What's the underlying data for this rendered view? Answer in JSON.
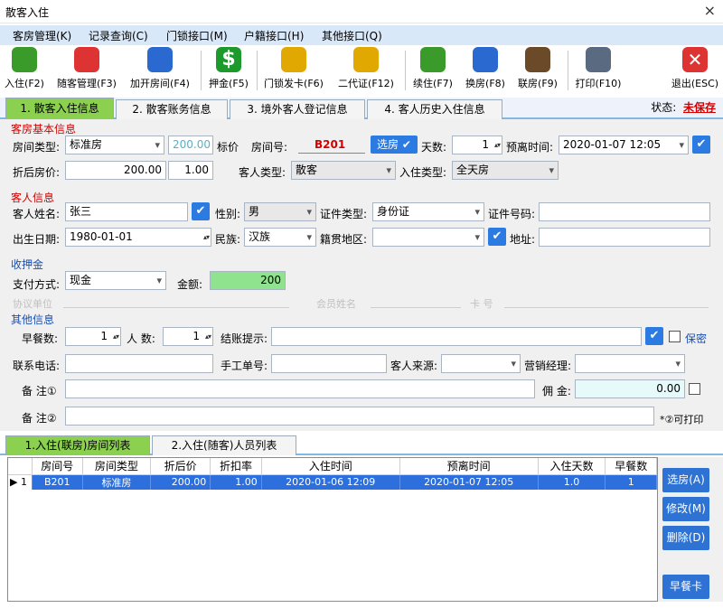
{
  "window": {
    "title": "散客入住",
    "close": "×"
  },
  "menu": [
    "客房管理(K)",
    "记录查询(C)",
    "门锁接口(M)",
    "户籍接口(H)",
    "其他接口(Q)"
  ],
  "toolbar": [
    {
      "label": "入住(F2)",
      "icon": "checkin-person-icon",
      "color": "#3a9a2a"
    },
    {
      "label": "随客管理(F3)",
      "icon": "guest-card-add-icon",
      "color": "#d33"
    },
    {
      "label": "加开房间(F4)",
      "icon": "cubes-icon",
      "color": "#2a6ad0"
    },
    {
      "label": "押金(F5)",
      "icon": "dollar-icon",
      "color": "#1c9a2c"
    },
    {
      "label": "门锁发卡(F6)",
      "icon": "key-card-icon",
      "color": "#e0a800"
    },
    {
      "label": "二代证(F12)",
      "icon": "id-keys-icon",
      "color": "#e0a800"
    },
    {
      "label": "续住(F7)",
      "icon": "add-person-icon",
      "color": "#3a9a2a"
    },
    {
      "label": "换房(F8)",
      "icon": "swap-person-icon",
      "color": "#2a6ad0"
    },
    {
      "label": "联房(F9)",
      "icon": "tools-icon",
      "color": "#6b4a2a"
    },
    {
      "label": "打印(F10)",
      "icon": "printer-icon",
      "color": "#5a6a80"
    },
    {
      "label": "退出(ESC)",
      "icon": "exit-x-icon",
      "color": "#d33"
    }
  ],
  "tabs": [
    "1. 散客入住信息",
    "2. 散客账务信息",
    "3. 境外客人登记信息",
    "4. 客人历史入住信息"
  ],
  "status": {
    "label": "状态:",
    "value": "未保存"
  },
  "room": {
    "section": "客房基本信息",
    "room_type_label": "房间类型:",
    "room_type": "标准房",
    "std_price": "200.00",
    "std_price_label": "标价",
    "room_no_label": "房间号:",
    "room_no": "B201",
    "select_room": "选房",
    "days_label": "天数:",
    "days": "1",
    "depart_label": "预离时间:",
    "depart": "2020-01-07 12:05",
    "discount_price_label": "折后房价:",
    "discount_price": "200.00",
    "discount_rate": "1.00",
    "guest_type_label": "客人类型:",
    "guest_type": "散客",
    "checkin_type_label": "入住类型:",
    "checkin_type": "全天房"
  },
  "guest": {
    "section": "客人信息",
    "name_label": "客人姓名:",
    "name": "张三",
    "gender_label": "性别:",
    "gender": "男",
    "id_type_label": "证件类型:",
    "id_type": "身份证",
    "id_no_label": "证件号码:",
    "id_no": "",
    "birth_label": "出生日期:",
    "birth": "1980-01-01",
    "nation_label": "民族:",
    "nation": "汉族",
    "origin_label": "籍贯地区:",
    "origin": "",
    "address_label": "地址:",
    "address": ""
  },
  "deposit": {
    "section": "收押金",
    "pay_label": "支付方式:",
    "pay": "现金",
    "amount_label": "金额:",
    "amount": "200",
    "faint": [
      "协议单位",
      "会员姓名",
      "卡 号"
    ]
  },
  "other": {
    "section": "其他信息",
    "breakfast_label": "早餐数:",
    "breakfast": "1",
    "people_label": "人 数:",
    "people": "1",
    "checkout_tip_label": "结账提示:",
    "secret_label": "保密",
    "phone_label": "联系电话:",
    "manual_label": "手工单号:",
    "source_label": "客人来源:",
    "manager_label": "营销经理:",
    "note1_label": "备 注①",
    "commission_label": "佣 金:",
    "commission": "0.00",
    "note2_label": "备 注②",
    "printable": "*②可打印"
  },
  "bottom_tabs": [
    "1.入住(联房)房间列表",
    "2.入住(随客)人员列表"
  ],
  "grid": {
    "headers": [
      "房间号",
      "房间类型",
      "折后价",
      "折扣率",
      "入住时间",
      "预离时间",
      "入住天数",
      "早餐数"
    ],
    "rows": [
      [
        "B201",
        "标准房",
        "200.00",
        "1.00",
        "2020-01-06 12:09",
        "2020-01-07 12:05",
        "1.0",
        "1"
      ]
    ],
    "row_marker": "▶ 1"
  },
  "side_buttons": [
    "选房(A)",
    "修改(M)",
    "删除(D)",
    "早餐卡"
  ]
}
